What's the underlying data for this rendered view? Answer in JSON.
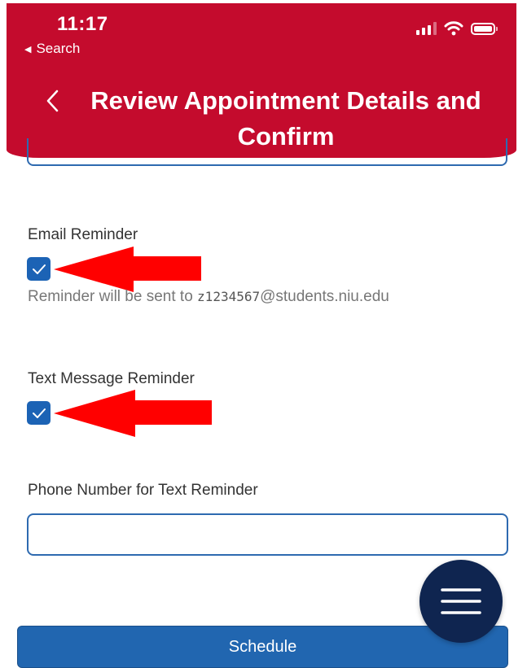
{
  "status_bar": {
    "time": "11:17",
    "back_label": "Search"
  },
  "header": {
    "title": "Review Appointment Details and Confirm",
    "background_color": "#c40b2d"
  },
  "email_reminder": {
    "label": "Email Reminder",
    "checked": true,
    "helper_prefix": "Reminder will be sent to ",
    "helper_id": "z1234567",
    "helper_suffix": "@students.niu.edu"
  },
  "text_reminder": {
    "label": "Text Message Reminder",
    "checked": true
  },
  "phone": {
    "label": "Phone Number for Text Reminder",
    "value": ""
  },
  "actions": {
    "schedule_label": "Schedule",
    "menu_icon": "hamburger-menu-icon"
  },
  "colors": {
    "accent_blue": "#1c63b5",
    "fab_navy": "#0f2550",
    "annotation_arrow": "#ff0000"
  }
}
